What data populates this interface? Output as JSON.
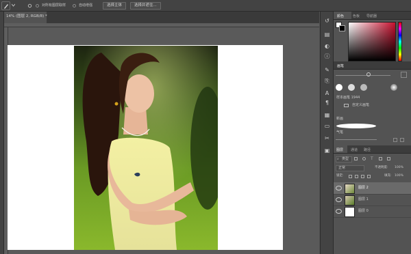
{
  "options_bar": {
    "sample_all_layers": "对所有图层取样",
    "auto_enhance": "自动增强",
    "select_subject_button": "选择主体",
    "select_and_mask_button": "选择并遮住..."
  },
  "document_tab": {
    "title": "14% (图层 2, RGB/8) *"
  },
  "color_panel": {
    "tabs": [
      "颜色",
      "色板",
      "导航器"
    ],
    "active_tab": "颜色",
    "hue_color": "#c8102e"
  },
  "brush_panel": {
    "tab": "画笔",
    "size_label": "样本画笔 1944",
    "preset_folder": "自定义画笔",
    "new_label": "新画",
    "subfolder_label": "气笔"
  },
  "layers_panel": {
    "tabs": [
      "图层",
      "通道",
      "路径"
    ],
    "active_tab": "图层",
    "filter_kind": "类型",
    "blend_mode": "正常",
    "opacity_label": "不透明度:",
    "opacity_value": "100%",
    "lock_label": "锁定:",
    "fill_label": "填充:",
    "fill_value": "100%",
    "layers": [
      {
        "name": "图层 2",
        "selected": true
      },
      {
        "name": "图层 1",
        "selected": false
      },
      {
        "name": "图层 0",
        "selected": false
      }
    ]
  }
}
